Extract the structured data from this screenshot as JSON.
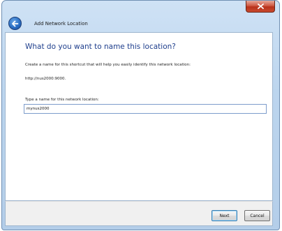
{
  "window": {
    "title": "Add Network Location",
    "close_icon": "close-icon",
    "back_icon": "back-arrow-icon"
  },
  "content": {
    "heading": "What do you want to name this location?",
    "instructions": "Create a name for this shortcut that will help you easily identify this network location:",
    "url": "http://nus2000:9000.",
    "field_label": "Type a name for this network location:",
    "field_value": "mynus2000"
  },
  "footer": {
    "next_label": "Next",
    "cancel_label": "Cancel"
  },
  "colors": {
    "heading": "#1e3e8c",
    "close_button": "#c94a30",
    "chrome": "#bcd5ee"
  }
}
